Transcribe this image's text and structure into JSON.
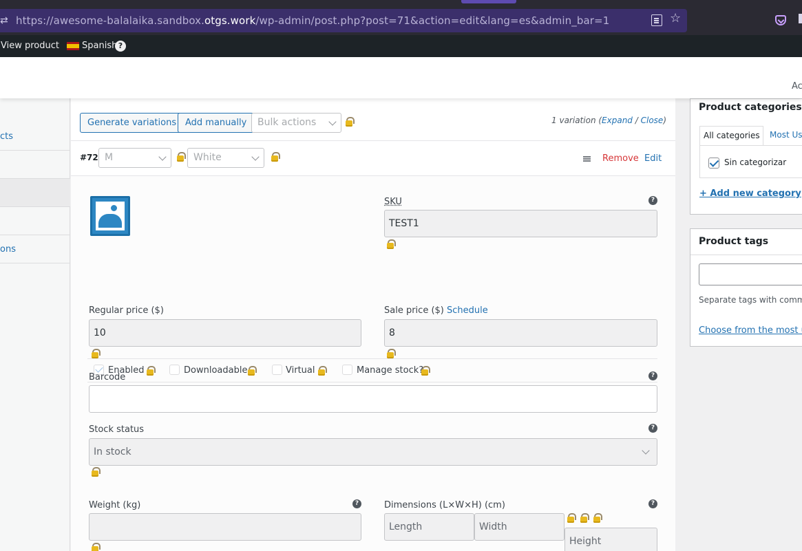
{
  "browser": {
    "url_scheme": "https://awesome-balalaika.sandbox.",
    "url_host": "otgs.work",
    "url_path": "/wp-admin/post.php?post=71&action=edit&lang=es&admin_bar=1",
    "url_icon": "⇄"
  },
  "admin_bar": {
    "view_product": "View product",
    "language": "Spanish",
    "help": "?"
  },
  "header": {
    "right_text": "Ac"
  },
  "left_menu": {
    "items": [
      "cts",
      "",
      "",
      "",
      "ons"
    ]
  },
  "variations": {
    "generate_label": "Generate variations",
    "add_manually_label": "Add manually",
    "bulk_actions": "Bulk actions",
    "count_prefix": "1 variation (",
    "expand": "Expand",
    "sep": " / ",
    "close": "Close",
    "count_suffix": ")",
    "row": {
      "id": "#72",
      "size": "M",
      "color": "White",
      "remove": "Remove",
      "edit": "Edit"
    },
    "sku_label": "SKU",
    "sku_value": "TEST1",
    "options": {
      "enabled": "Enabled",
      "downloadable": "Downloadable",
      "virtual": "Virtual",
      "manage_stock": "Manage stock?"
    },
    "regular_price_label": "Regular price ($)",
    "regular_price": "10",
    "sale_price_label": "Sale price ($)",
    "schedule": "Schedule",
    "sale_price": "8",
    "barcode_label": "Barcode",
    "stock_status_label": "Stock status",
    "stock_status": "In stock",
    "weight_label": "Weight (kg)",
    "dimensions_label": "Dimensions (L×W×H) (cm)",
    "length_ph": "Length",
    "width_ph": "Width",
    "height_ph": "Height"
  },
  "sidebar": {
    "categories": {
      "title": "Product categories",
      "tab_all": "All categories",
      "tab_most": "Most Us",
      "item": "Sin categorizar",
      "add_new": "+ Add new category"
    },
    "tags": {
      "title": "Product tags",
      "hint": "Separate tags with comma",
      "choose": "Choose from the most use"
    }
  },
  "colors": {
    "accent": "#2271b1",
    "danger": "#d63638",
    "admin_bar": "#1d2327",
    "browser_url": "#3b2f6b"
  }
}
